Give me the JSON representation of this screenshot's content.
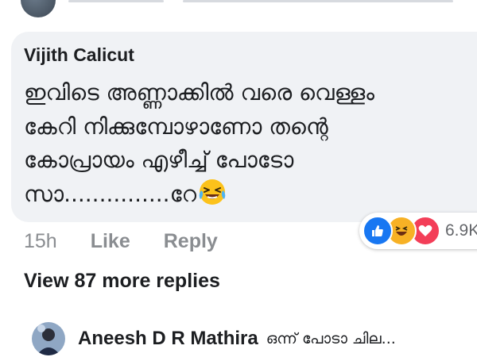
{
  "previous_comment": {
    "avatar_icon": "user-avatar-icon"
  },
  "comment": {
    "author": "Vijith Calicut",
    "lines": [
      "ഇവിടെ അണ്ണാക്കിൽ വരെ വെള്ളം",
      "കേറി നിക്കുമ്പോഴാണോ തന്റെ",
      "കോപ്രായം എഴീച്ച് പോടോ",
      "സാ...............റേ"
    ],
    "trailing_emoji": "laughing-tears-emoji",
    "timestamp": "15h",
    "like_label": "Like",
    "reply_label": "Reply",
    "reactions": {
      "icons": [
        "like-reaction-icon",
        "haha-reaction-icon",
        "love-reaction-icon"
      ],
      "count": "6.9K"
    }
  },
  "view_more_replies": "View 87 more replies",
  "latest_reply": {
    "author": "Aneesh D R Mathira",
    "preview": "ഒന്ന് പോടാ ചില..."
  },
  "colors": {
    "bubble_bg": "#f0f2f5",
    "text_primary": "#1c1e21",
    "text_secondary": "#8a8d91",
    "like_blue": "#1877f2",
    "haha_yellow": "#f7b125",
    "love_red": "#f33e58"
  }
}
